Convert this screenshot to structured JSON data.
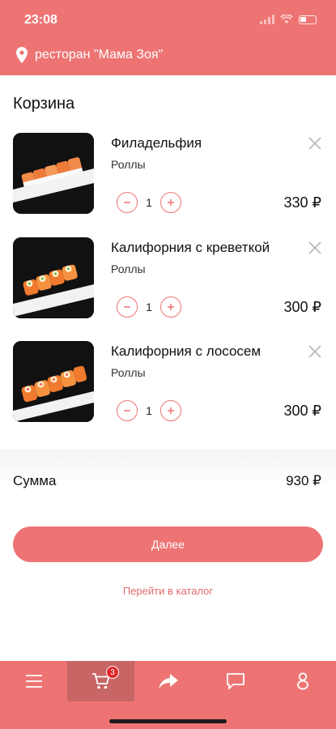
{
  "status_bar": {
    "time": "23:08"
  },
  "header": {
    "restaurant": "ресторан \"Мама Зоя\"",
    "location_icon": "location-pin-icon"
  },
  "cart": {
    "title": "Корзина",
    "items": [
      {
        "name": "Филадельфия",
        "category": "Роллы",
        "quantity": "1",
        "price": "330 ₽"
      },
      {
        "name": "Калифорния с креветкой",
        "category": "Роллы",
        "quantity": "1",
        "price": "300 ₽"
      },
      {
        "name": "Калифорния с лососем",
        "category": "Роллы",
        "quantity": "1",
        "price": "300 ₽"
      }
    ],
    "sum_label": "Сумма",
    "sum_value": "930 ₽",
    "next_label": "Далее",
    "catalog_link": "Перейти в каталог"
  },
  "tabbar": {
    "cart_badge": "3",
    "tabs": [
      "menu-icon",
      "cart-icon",
      "share-icon",
      "chat-icon",
      "profile-icon"
    ]
  },
  "colors": {
    "accent": "#ee7474",
    "active_tab": "#c86565",
    "badge": "#e3262b"
  }
}
